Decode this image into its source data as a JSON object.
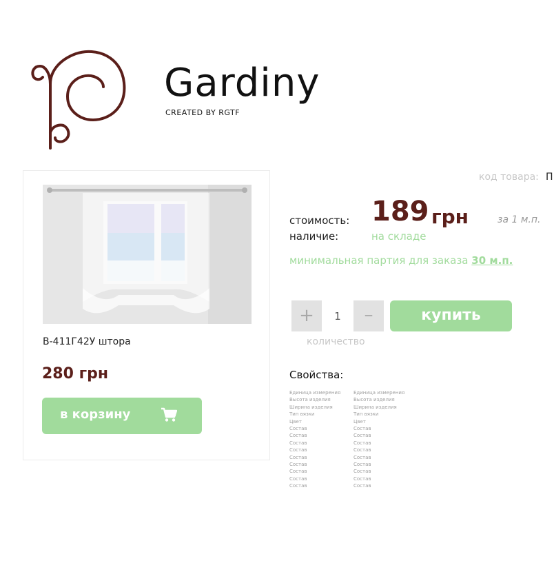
{
  "brand": {
    "name": "Gardiny",
    "tagline": "CREATED BY RGTF",
    "colors": {
      "logo": "#5b1f1a",
      "accent": "#a1db9c",
      "price": "#5b1f1a"
    }
  },
  "card": {
    "image_icon": "curtain-window-image",
    "title": "В-411Г42У штора",
    "price": "280 грн",
    "cart_label": "в корзину",
    "cart_icon": "shopping-cart-icon"
  },
  "product": {
    "sku_label": "код  товара:",
    "sku_value": "П",
    "price_label": "стоимость:",
    "price_value": "189",
    "price_currency": "грн",
    "per_unit": "за 1 м.п.",
    "stock_label": "наличие:",
    "stock_value": "на складе",
    "min_order_text": "минимальная партия для заказа",
    "min_order_qty": "30 м.п."
  },
  "quantity": {
    "plus": "+",
    "value": "1",
    "minus": "–",
    "caption": "количество"
  },
  "buy_label": "купить",
  "properties": {
    "title": "Свойства:",
    "names": [
      "Единица измерения",
      "Высота изделия",
      "Ширина изделия",
      "Тип вязки",
      "Цвет",
      "Состав",
      "Состав",
      "Состав",
      "Состав",
      "Состав",
      "Состав",
      "Состав",
      "Состав",
      "Состав"
    ],
    "values": [
      "Единица измерения",
      "Высота изделия",
      "Ширина изделия",
      "Тип вязки",
      "Цвет",
      "Состав",
      "Состав",
      "Состав",
      "Состав",
      "Состав",
      "Состав",
      "Состав",
      "Состав",
      "Состав"
    ]
  }
}
